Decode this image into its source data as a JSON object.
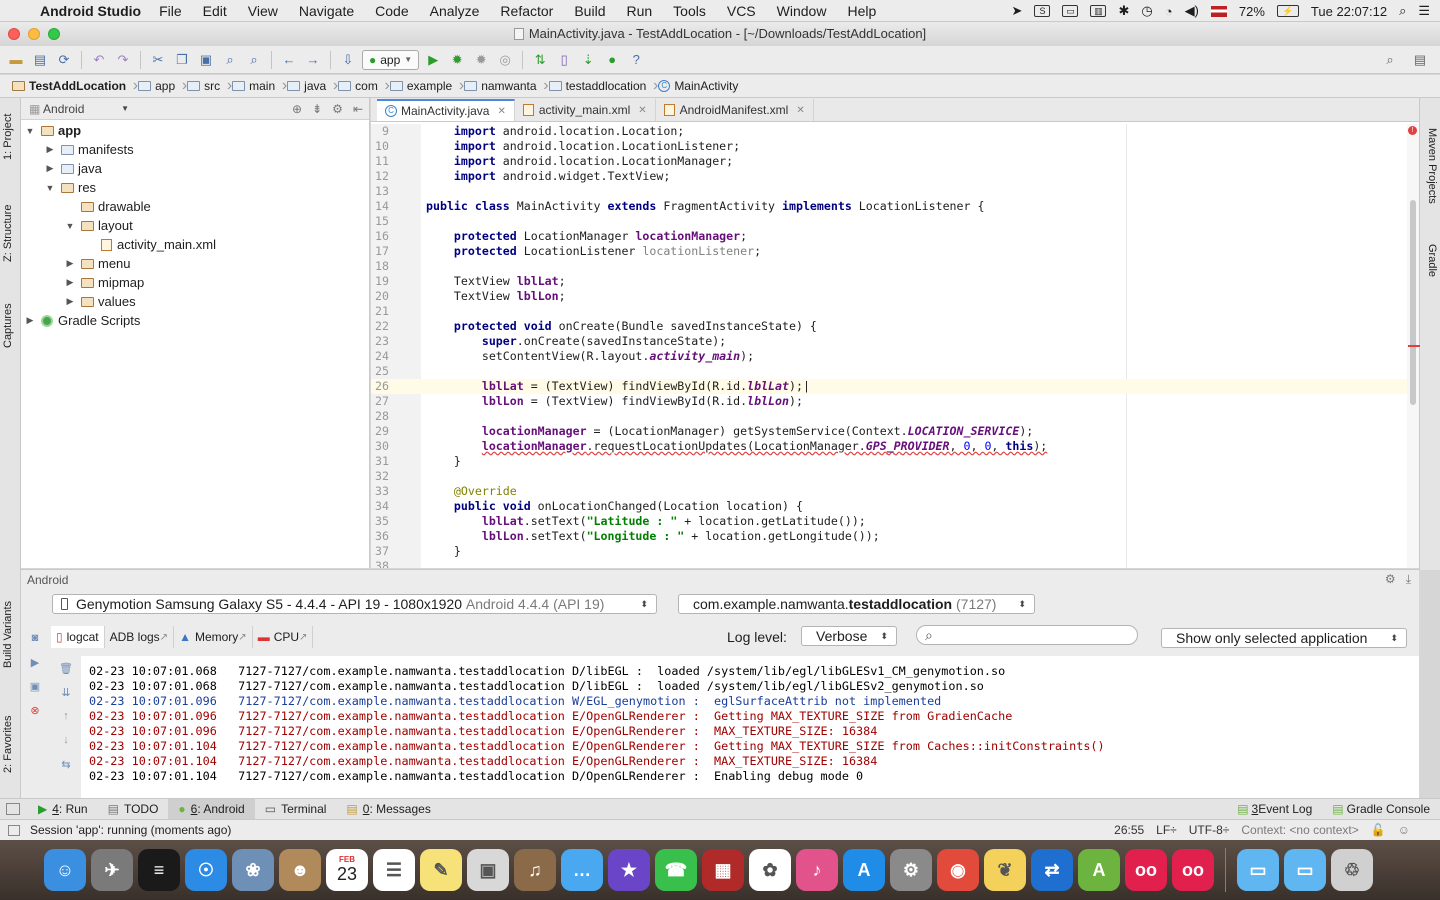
{
  "menubar": {
    "app_name": "Android Studio",
    "items": [
      "File",
      "Edit",
      "View",
      "Navigate",
      "Code",
      "Analyze",
      "Refactor",
      "Build",
      "Run",
      "Tools",
      "VCS",
      "Window",
      "Help"
    ],
    "battery": "72%",
    "clock": "Tue 22:07:12"
  },
  "window": {
    "title": "MainActivity.java - TestAddLocation - [~/Downloads/TestAddLocation]"
  },
  "toolbar": {
    "run_config": "app"
  },
  "breadcrumb": [
    "TestAddLocation",
    "app",
    "src",
    "main",
    "java",
    "com",
    "example",
    "namwanta",
    "testaddlocation",
    "MainActivity"
  ],
  "left_strip": {
    "tabs": [
      "1: Project",
      "Z: Structure",
      "Captures",
      "Build Variants",
      "2: Favorites"
    ]
  },
  "right_strip": {
    "tabs": [
      "Maven Projects",
      "Gradle"
    ]
  },
  "project": {
    "view_selector": "Android",
    "tree": [
      {
        "label": "app",
        "level": 0,
        "expanded": true,
        "type": "module"
      },
      {
        "label": "manifests",
        "level": 1,
        "expanded": false,
        "type": "folder"
      },
      {
        "label": "java",
        "level": 1,
        "expanded": false,
        "type": "folder"
      },
      {
        "label": "res",
        "level": 1,
        "expanded": true,
        "type": "res"
      },
      {
        "label": "drawable",
        "level": 2,
        "expanded": null,
        "type": "res"
      },
      {
        "label": "layout",
        "level": 2,
        "expanded": true,
        "type": "res"
      },
      {
        "label": "activity_main.xml",
        "level": 3,
        "expanded": null,
        "type": "xml"
      },
      {
        "label": "menu",
        "level": 2,
        "expanded": false,
        "type": "res"
      },
      {
        "label": "mipmap",
        "level": 2,
        "expanded": false,
        "type": "res"
      },
      {
        "label": "values",
        "level": 2,
        "expanded": false,
        "type": "res"
      },
      {
        "label": "Gradle Scripts",
        "level": 0,
        "expanded": false,
        "type": "gradle"
      }
    ]
  },
  "editor": {
    "tabs": [
      {
        "label": "MainActivity.java",
        "active": true
      },
      {
        "label": "activity_main.xml",
        "active": false
      },
      {
        "label": "AndroidManifest.xml",
        "active": false
      }
    ],
    "current_line": 26,
    "lines": [
      {
        "n": "9",
        "html": "    <span class='kw'>import</span> android.location.Location;"
      },
      {
        "n": "10",
        "html": "    <span class='kw'>import</span> android.location.LocationListener;"
      },
      {
        "n": "11",
        "html": "    <span class='kw'>import</span> android.location.LocationManager;"
      },
      {
        "n": "12",
        "html": "    <span class='kw'>import</span> android.widget.TextView;"
      },
      {
        "n": "13",
        "html": ""
      },
      {
        "n": "14",
        "html": "<span class='kw'>public class</span> MainActivity <span class='kw'>extends</span> FragmentActivity <span class='kw'>implements</span> LocationListener {"
      },
      {
        "n": "15",
        "html": ""
      },
      {
        "n": "16",
        "html": "    <span class='kw'>protected</span> LocationManager <span class='fld'>locationManager</span>;"
      },
      {
        "n": "17",
        "html": "    <span class='kw'>protected</span> LocationListener <span class='unused'>locationListener</span>;"
      },
      {
        "n": "18",
        "html": ""
      },
      {
        "n": "19",
        "html": "    TextView <span class='fld'>lblLat</span>;"
      },
      {
        "n": "20",
        "html": "    TextView <span class='fld'>lblLon</span>;"
      },
      {
        "n": "21",
        "html": ""
      },
      {
        "n": "22",
        "html": "    <span class='kw'>protected void</span> onCreate(Bundle savedInstanceState) {"
      },
      {
        "n": "23",
        "html": "        <span class='kw'>super</span>.onCreate(savedInstanceState);"
      },
      {
        "n": "24",
        "html": "        setContentView(R.layout.<span class='fld-i'>activity_main</span>);"
      },
      {
        "n": "25",
        "html": ""
      },
      {
        "n": "26",
        "html": "        <span class='fld'>lblLat</span> = (TextView) findViewById(R.id.<span class='fld-i'>lblLat</span>);|"
      },
      {
        "n": "27",
        "html": "        <span class='fld'>lblLon</span> = (TextView) findViewById(R.id.<span class='fld-i'>lblLon</span>);"
      },
      {
        "n": "28",
        "html": ""
      },
      {
        "n": "29",
        "html": "        <span class='fld'>locationManager</span> = (LocationManager) getSystemService(Context.<span class='fld-i'>LOCATION_SERVICE</span>);"
      },
      {
        "n": "30",
        "html": "        <span class='err'><span class='fld'>locationManager</span>.requestLocationUpdates(LocationManager.<span class='fld-i'>GPS_PROVIDER</span>, <span class='num'>0</span>, <span class='num'>0</span>, <span class='kw'>this</span>);</span>"
      },
      {
        "n": "31",
        "html": "    }"
      },
      {
        "n": "32",
        "html": ""
      },
      {
        "n": "33",
        "html": "    <span class='ann'>@Override</span>"
      },
      {
        "n": "34",
        "html": "    <span class='kw'>public void</span> onLocationChanged(Location location) {"
      },
      {
        "n": "35",
        "html": "        <span class='fld'>lblLat</span>.setText(<span class='str'>\"Latitude : \"</span> + location.getLatitude());"
      },
      {
        "n": "36",
        "html": "        <span class='fld'>lblLon</span>.setText(<span class='str'>\"Longitude : \"</span> + location.getLongitude());"
      },
      {
        "n": "37",
        "html": "    }"
      },
      {
        "n": "38",
        "html": ""
      }
    ]
  },
  "android_panel": {
    "title": "Android",
    "device": "Genymotion Samsung Galaxy S5 - 4.4.4 - API 19 - 1080x1920",
    "device_os": "Android 4.4.4 (API 19)",
    "process_prefix": "com.example.namwanta.",
    "process_name": "testaddlocation",
    "process_pid": "(7127)",
    "subtabs": [
      {
        "label": "logcat",
        "active": true
      },
      {
        "label": "ADB logs",
        "active": false
      },
      {
        "label": "Memory",
        "active": false
      },
      {
        "label": "CPU",
        "active": false
      }
    ],
    "log_level_label": "Log level:",
    "log_level": "Verbose",
    "search_placeholder": "",
    "filter": "Show only selected application",
    "log_lines": [
      {
        "level": "d",
        "text": "02-23 10:07:01.068   7127-7127/com.example.namwanta.testaddlocation D/libEGL :  loaded /system/lib/egl/libGLESv1_CM_genymotion.so"
      },
      {
        "level": "d",
        "text": "02-23 10:07:01.068   7127-7127/com.example.namwanta.testaddlocation D/libEGL :  loaded /system/lib/egl/libGLESv2_genymotion.so"
      },
      {
        "level": "w",
        "text": "02-23 10:07:01.096   7127-7127/com.example.namwanta.testaddlocation W/EGL_genymotion :  eglSurfaceAttrib not implemented"
      },
      {
        "level": "e",
        "text": "02-23 10:07:01.096   7127-7127/com.example.namwanta.testaddlocation E/OpenGLRenderer :  Getting MAX_TEXTURE_SIZE from GradienCache"
      },
      {
        "level": "e",
        "text": "02-23 10:07:01.096   7127-7127/com.example.namwanta.testaddlocation E/OpenGLRenderer :  MAX_TEXTURE_SIZE: 16384"
      },
      {
        "level": "e",
        "text": "02-23 10:07:01.104   7127-7127/com.example.namwanta.testaddlocation E/OpenGLRenderer :  Getting MAX_TEXTURE_SIZE from Caches::initConstraints()"
      },
      {
        "level": "e",
        "text": "02-23 10:07:01.104   7127-7127/com.example.namwanta.testaddlocation E/OpenGLRenderer :  MAX_TEXTURE_SIZE: 16384"
      },
      {
        "level": "d",
        "text": "02-23 10:07:01.104   7127-7127/com.example.namwanta.testaddlocation D/OpenGLRenderer :  Enabling debug mode 0"
      }
    ]
  },
  "bottom_tabs": {
    "left": [
      {
        "key": "4",
        "label": ": Run",
        "active": false
      },
      {
        "key": "",
        "label": "TODO",
        "active": false
      },
      {
        "key": "6",
        "label": ": Android",
        "active": true
      },
      {
        "key": "",
        "label": "Terminal",
        "active": false
      },
      {
        "key": "0",
        "label": ": Messages",
        "active": false
      }
    ],
    "right": [
      {
        "key": "3",
        "label": " Event Log"
      },
      {
        "key": "",
        "label": "Gradle Console"
      }
    ]
  },
  "statusbar": {
    "message": "Session 'app': running (moments ago)",
    "position": "26:55",
    "line_sep": "LF÷",
    "encoding": "UTF-8÷",
    "context": "Context: <no context>"
  },
  "dock": {
    "calendar_month": "FEB",
    "calendar_day": "23",
    "apps": [
      {
        "name": "finder-icon",
        "bg": "#3b8fe0",
        "glyph": "☺"
      },
      {
        "name": "launchpad-icon",
        "bg": "#7a7a7a",
        "glyph": "✈"
      },
      {
        "name": "activity-monitor-icon",
        "bg": "#1a1a1a",
        "glyph": "≡"
      },
      {
        "name": "safari-icon",
        "bg": "#2b8be5",
        "glyph": "☉"
      },
      {
        "name": "preview-icon",
        "bg": "#6e90b6",
        "glyph": "❀"
      },
      {
        "name": "contacts-icon",
        "bg": "#b08a5a",
        "glyph": "☻"
      },
      {
        "name": "calendar-icon",
        "bg": "#ffffff",
        "glyph": ""
      },
      {
        "name": "reminders-icon",
        "bg": "#ffffff",
        "glyph": "☰"
      },
      {
        "name": "notes-icon",
        "bg": "#f7e27a",
        "glyph": "✎"
      },
      {
        "name": "photo-booth-icon",
        "bg": "#d8d8d8",
        "glyph": "▣"
      },
      {
        "name": "guitar-icon",
        "bg": "#8a6a48",
        "glyph": "♫"
      },
      {
        "name": "messages-icon",
        "bg": "#4aa8f0",
        "glyph": "…"
      },
      {
        "name": "imovie-icon",
        "bg": "#6b45c8",
        "glyph": "★"
      },
      {
        "name": "facetime-icon",
        "bg": "#39c04c",
        "glyph": "☎"
      },
      {
        "name": "photo-booth-red-icon",
        "bg": "#b02a2a",
        "glyph": "▦"
      },
      {
        "name": "photos-icon",
        "bg": "#ffffff",
        "glyph": "✿"
      },
      {
        "name": "itunes-icon",
        "bg": "#e2538c",
        "glyph": "♪"
      },
      {
        "name": "app-store-icon",
        "bg": "#1f8de8",
        "glyph": "A"
      },
      {
        "name": "system-preferences-icon",
        "bg": "#8a8a8a",
        "glyph": "⚙"
      },
      {
        "name": "chrome-icon",
        "bg": "#e24a3c",
        "glyph": "◉"
      },
      {
        "name": "cyberduck-icon",
        "bg": "#f3d15a",
        "glyph": "❦"
      },
      {
        "name": "teamviewer-icon",
        "bg": "#1f6fd0",
        "glyph": "⇄"
      },
      {
        "name": "android-studio-icon",
        "bg": "#6db33f",
        "glyph": "A"
      },
      {
        "name": "genymotion-icon",
        "bg": "#e2204d",
        "glyph": "oo"
      },
      {
        "name": "genymotion-player-icon",
        "bg": "#e2204d",
        "glyph": "oo"
      }
    ],
    "right": [
      {
        "name": "applications-folder-icon",
        "bg": "#5fb6f0",
        "glyph": "▭"
      },
      {
        "name": "downloads-folder-icon",
        "bg": "#5fb6f0",
        "glyph": "▭"
      },
      {
        "name": "trash-icon",
        "bg": "#d0d0d0",
        "glyph": "♲"
      }
    ]
  },
  "colors": {
    "keyword": "#000080",
    "field": "#660e7a",
    "string": "#008000",
    "annotation": "#808000",
    "error": "#e04040",
    "log_error": "#a00000",
    "log_warn": "#1a3d9c"
  }
}
